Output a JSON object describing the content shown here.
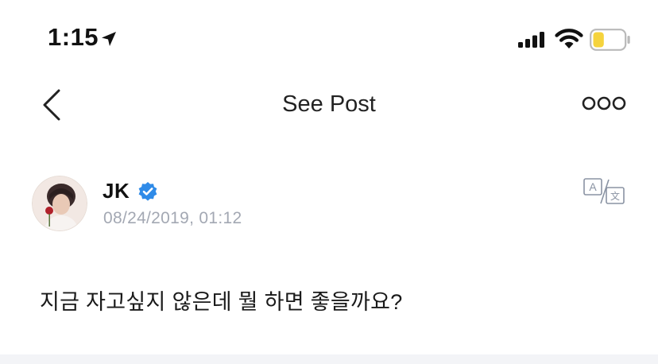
{
  "status_bar": {
    "time": "1:15",
    "location_icon": "location-arrow-icon",
    "signal_icon": "cellular-signal-icon",
    "wifi_icon": "wifi-icon",
    "battery_icon": "battery-icon",
    "battery_level": 0.35,
    "battery_color": "#f5d33d"
  },
  "nav": {
    "back_icon": "chevron-left-icon",
    "title": "See Post",
    "more_icon": "more-dots-icon"
  },
  "post": {
    "author": "JK",
    "verified": true,
    "verified_color": "#2f8be8",
    "timestamp": "08/24/2019, 01:12",
    "translate_icon": "translate-icon",
    "text": "지금 자고싶지 않은데 뭘 하면 좋을까요?"
  }
}
